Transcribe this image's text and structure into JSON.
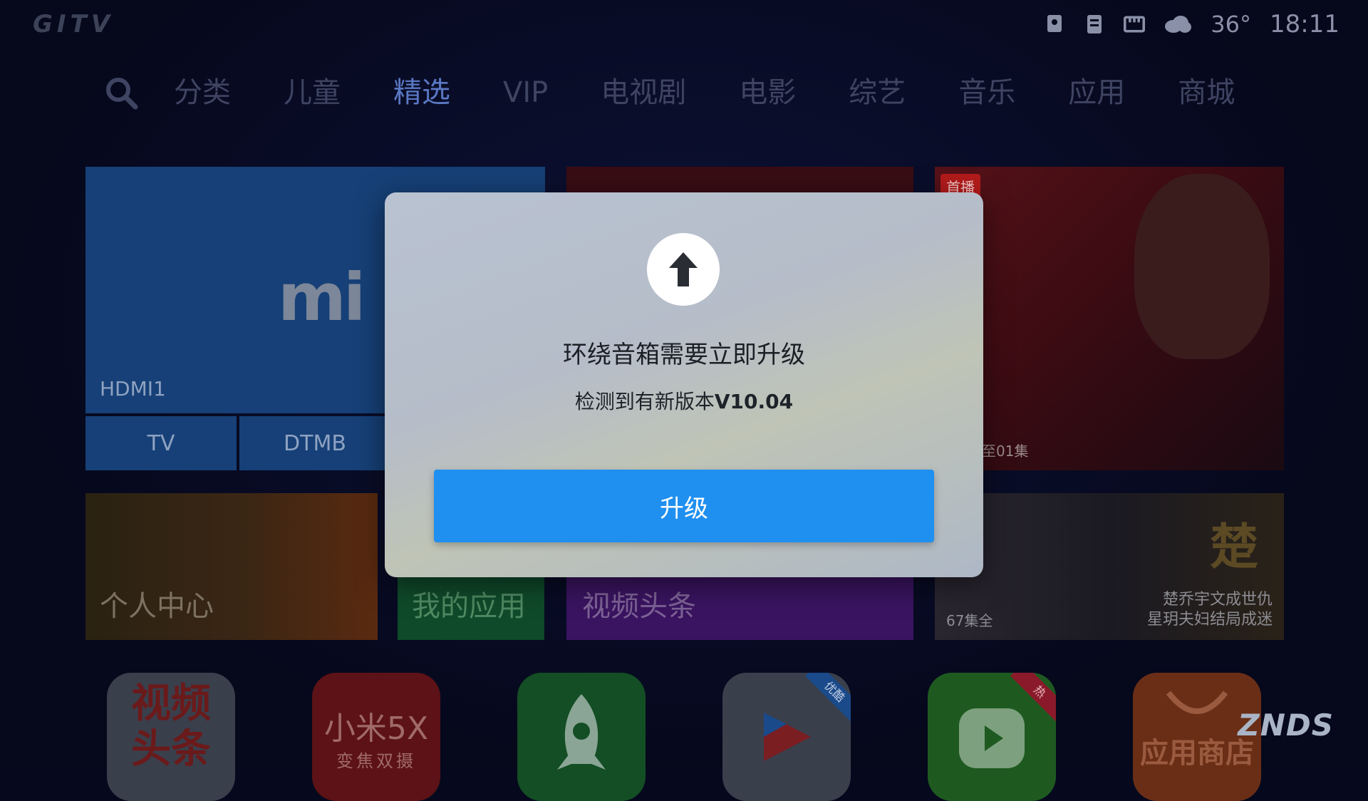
{
  "status_bar": {
    "logo": "GITV",
    "temperature": "36°",
    "time": "18:11",
    "icons": [
      "location-icon",
      "router-icon",
      "ethernet-icon",
      "cloud-icon"
    ]
  },
  "nav": {
    "items": [
      "分类",
      "儿童",
      "精选",
      "VIP",
      "电视剧",
      "电影",
      "综艺",
      "音乐",
      "应用",
      "商城"
    ],
    "active": "精选"
  },
  "tiles": {
    "hdmi": {
      "logo": "mi",
      "label": "HDMI1"
    },
    "sources": [
      "TV",
      "DTMB"
    ],
    "movie": {
      "badge": "首播",
      "episode": "至01集"
    },
    "personal": "个人中心",
    "my_apps": "我的应用",
    "video_headlines": "视频头条",
    "drama": {
      "title_char": "楚",
      "episodes": "67集全",
      "desc_line1": "楚乔宇文成世仇",
      "desc_line2": "星玥夫妇结局成迷"
    }
  },
  "apps": {
    "app1": {
      "line1": "视频",
      "line2": "头条"
    },
    "app2": {
      "line1": "小米5X",
      "line2": "变焦双摄"
    },
    "app4_corner": "优酷",
    "app5_corner": "热",
    "app6": "应用商店"
  },
  "watermark": "ZNDS",
  "dialog": {
    "title": "环绕音箱需要立即升级",
    "subtitle_prefix": "检测到有新版本",
    "version": "V10.04",
    "button": "升级"
  },
  "colors": {
    "accent": "#1f8ff0",
    "background": "#06091e",
    "nav_active": "#5a78c4"
  }
}
